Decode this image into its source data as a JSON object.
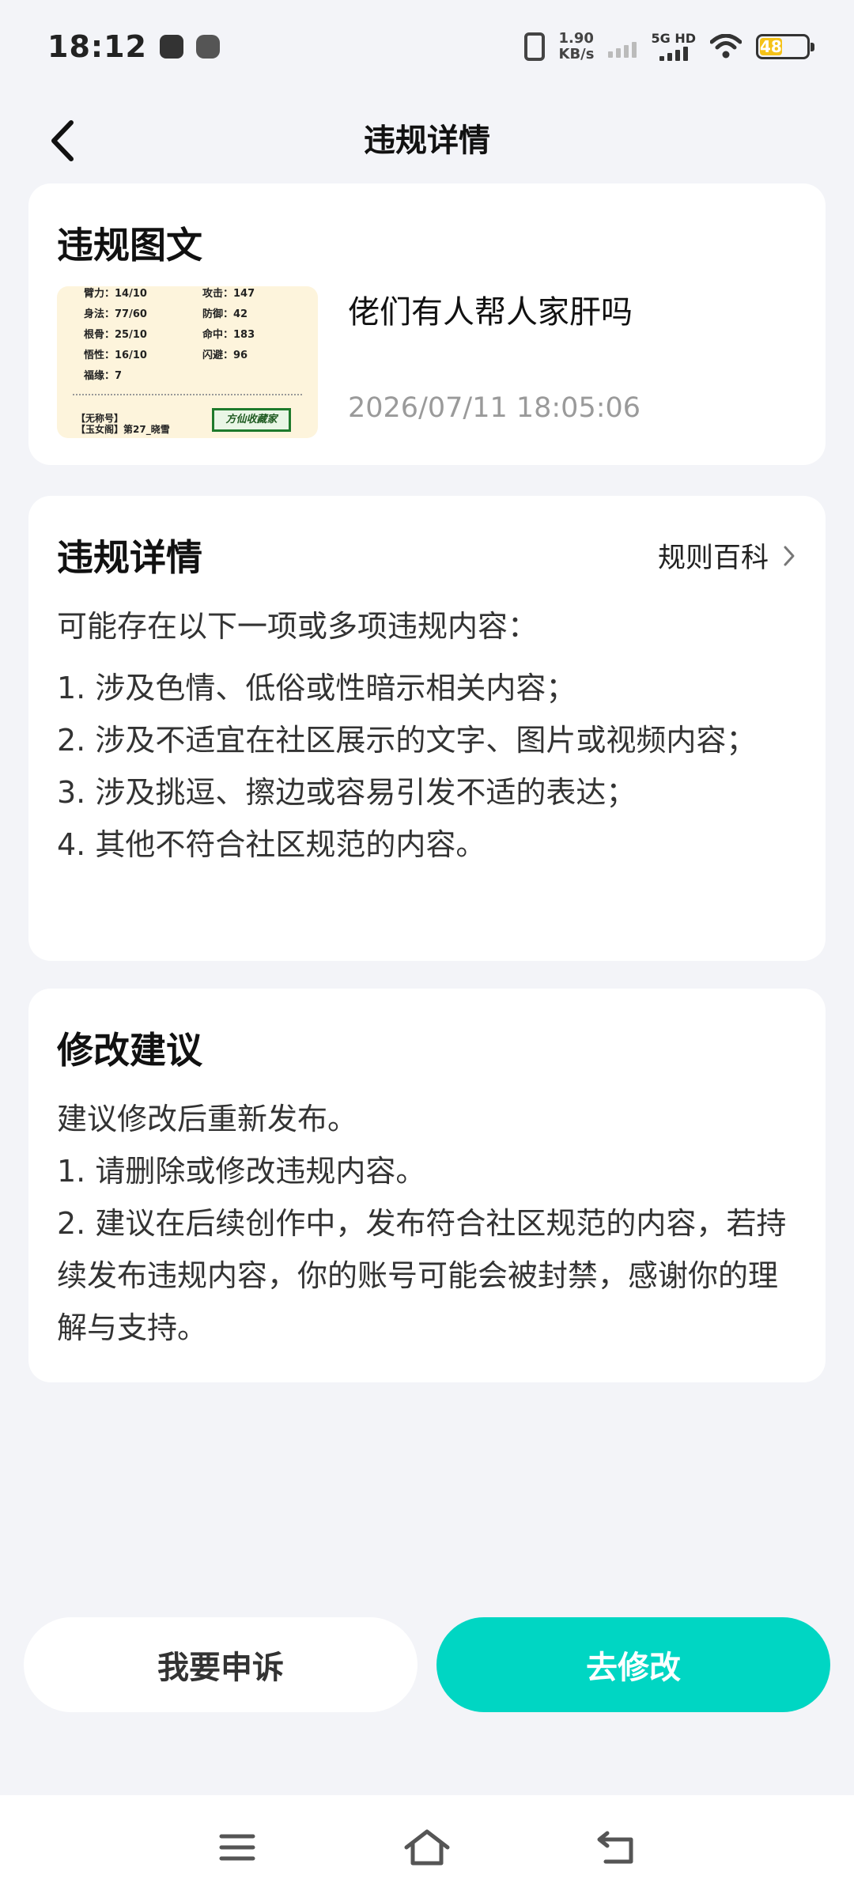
{
  "status_bar": {
    "time": "18:12",
    "net_speed_value": "1.90",
    "net_speed_unit": "KB/s",
    "network_type": "5G HD",
    "battery_level": "48",
    "battery_fraction": 0.48,
    "battery_color": "#f5c218"
  },
  "header": {
    "title": "违规详情",
    "back_icon": "chevron-left-icon"
  },
  "violation_post": {
    "section_title": "违规图文",
    "post_text": "佬们有人帮人家肝吗",
    "post_time": "2026/07/11 18:05:06",
    "thumbnail": {
      "stats": [
        {
          "label": "臂力：14/10",
          "value": ""
        },
        {
          "label": "攻击：147",
          "value": ""
        },
        {
          "label": "身法：77/60",
          "value": ""
        },
        {
          "label": "防御：42",
          "value": ""
        },
        {
          "label": "根骨：25/10",
          "value": ""
        },
        {
          "label": "命中：183",
          "value": ""
        },
        {
          "label": "悟性：16/10",
          "value": ""
        },
        {
          "label": "闪避：96",
          "value": ""
        },
        {
          "label": "福缘：7",
          "value": ""
        }
      ],
      "footer_line1": "【无称号】",
      "footer_line2": "【玉女阁】第27_晓雪",
      "stamp_text": "方仙收藏家"
    }
  },
  "violation_details": {
    "section_title": "违规详情",
    "rules_link_label": "规则百科",
    "intro": "可能存在以下一项或多项违规内容：",
    "items": [
      "1. 涉及色情、低俗或性暗示相关内容；",
      "2. 涉及不适宜在社区展示的文字、图片或视频内容；",
      "3. 涉及挑逗、擦边或容易引发不适的表达；",
      "4. 其他不符合社区规范的内容。"
    ]
  },
  "suggestions": {
    "section_title": "修改建议",
    "lines": [
      "建议修改后重新发布。",
      "1. 请删除或修改违规内容。",
      "2. 建议在后续创作中，发布符合社区规范的内容，若持续发布违规内容，你的账号可能会被封禁，感谢你的理解与支持。"
    ]
  },
  "actions": {
    "appeal_label": "我要申诉",
    "modify_label": "去修改",
    "accent_color": "#00d6c3"
  },
  "nav_bar": {
    "menu_icon": "menu-icon",
    "home_icon": "home-icon",
    "back_icon": "back-icon"
  }
}
